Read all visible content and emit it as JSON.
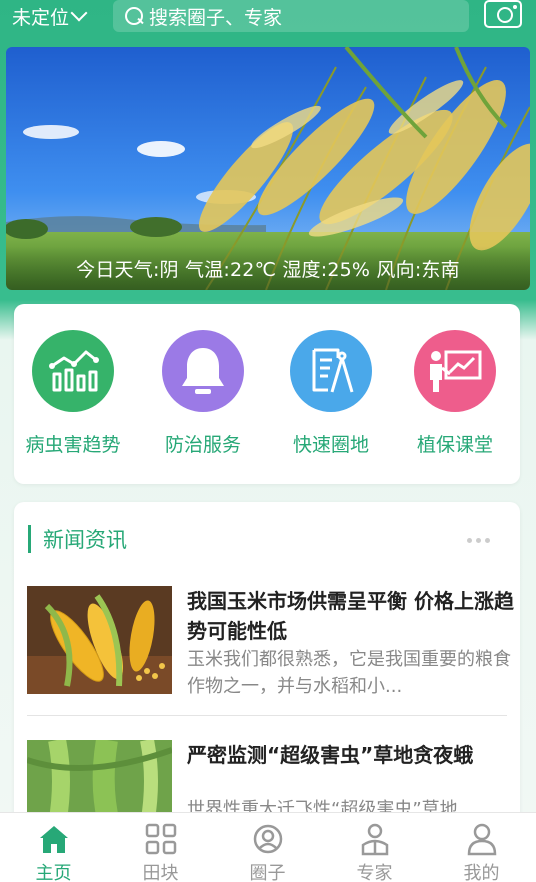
{
  "header": {
    "location": "未定位",
    "search_placeholder": "搜索圈子、专家"
  },
  "banner": {
    "weather": "今日天气:阴 气温:22℃ 湿度:25% 风向:东南"
  },
  "services": [
    {
      "label": "病虫害趋势",
      "color": "#36b36a",
      "icon": "trend-chart-icon"
    },
    {
      "label": "防治服务",
      "color": "#9b7ae6",
      "icon": "bell-icon"
    },
    {
      "label": "快速圈地",
      "color": "#4aa8ea",
      "icon": "drafting-compass-icon"
    },
    {
      "label": "植保课堂",
      "color": "#ee5d8c",
      "icon": "presentation-board-icon"
    }
  ],
  "news": {
    "title": "新闻资讯",
    "items": [
      {
        "headline": "我国玉米市场供需呈平衡 价格上涨趋势可能性低",
        "summary": "玉米我们都很熟悉，它是我国重要的粮食作物之一，并与水稻和小..."
      },
      {
        "headline": "严密监测“超级害虫”草地贪夜蛾",
        "summary": "世界性重大迁飞性“超级害虫”草地"
      }
    ]
  },
  "tabs": [
    {
      "label": "主页",
      "icon": "home-icon",
      "active": true
    },
    {
      "label": "田块",
      "icon": "grid-icon",
      "active": false
    },
    {
      "label": "圈子",
      "icon": "community-icon",
      "active": false
    },
    {
      "label": "专家",
      "icon": "expert-icon",
      "active": false
    },
    {
      "label": "我的",
      "icon": "user-icon",
      "active": false
    }
  ],
  "colors": {
    "accent": "#27a877",
    "header": "#2fb585"
  }
}
